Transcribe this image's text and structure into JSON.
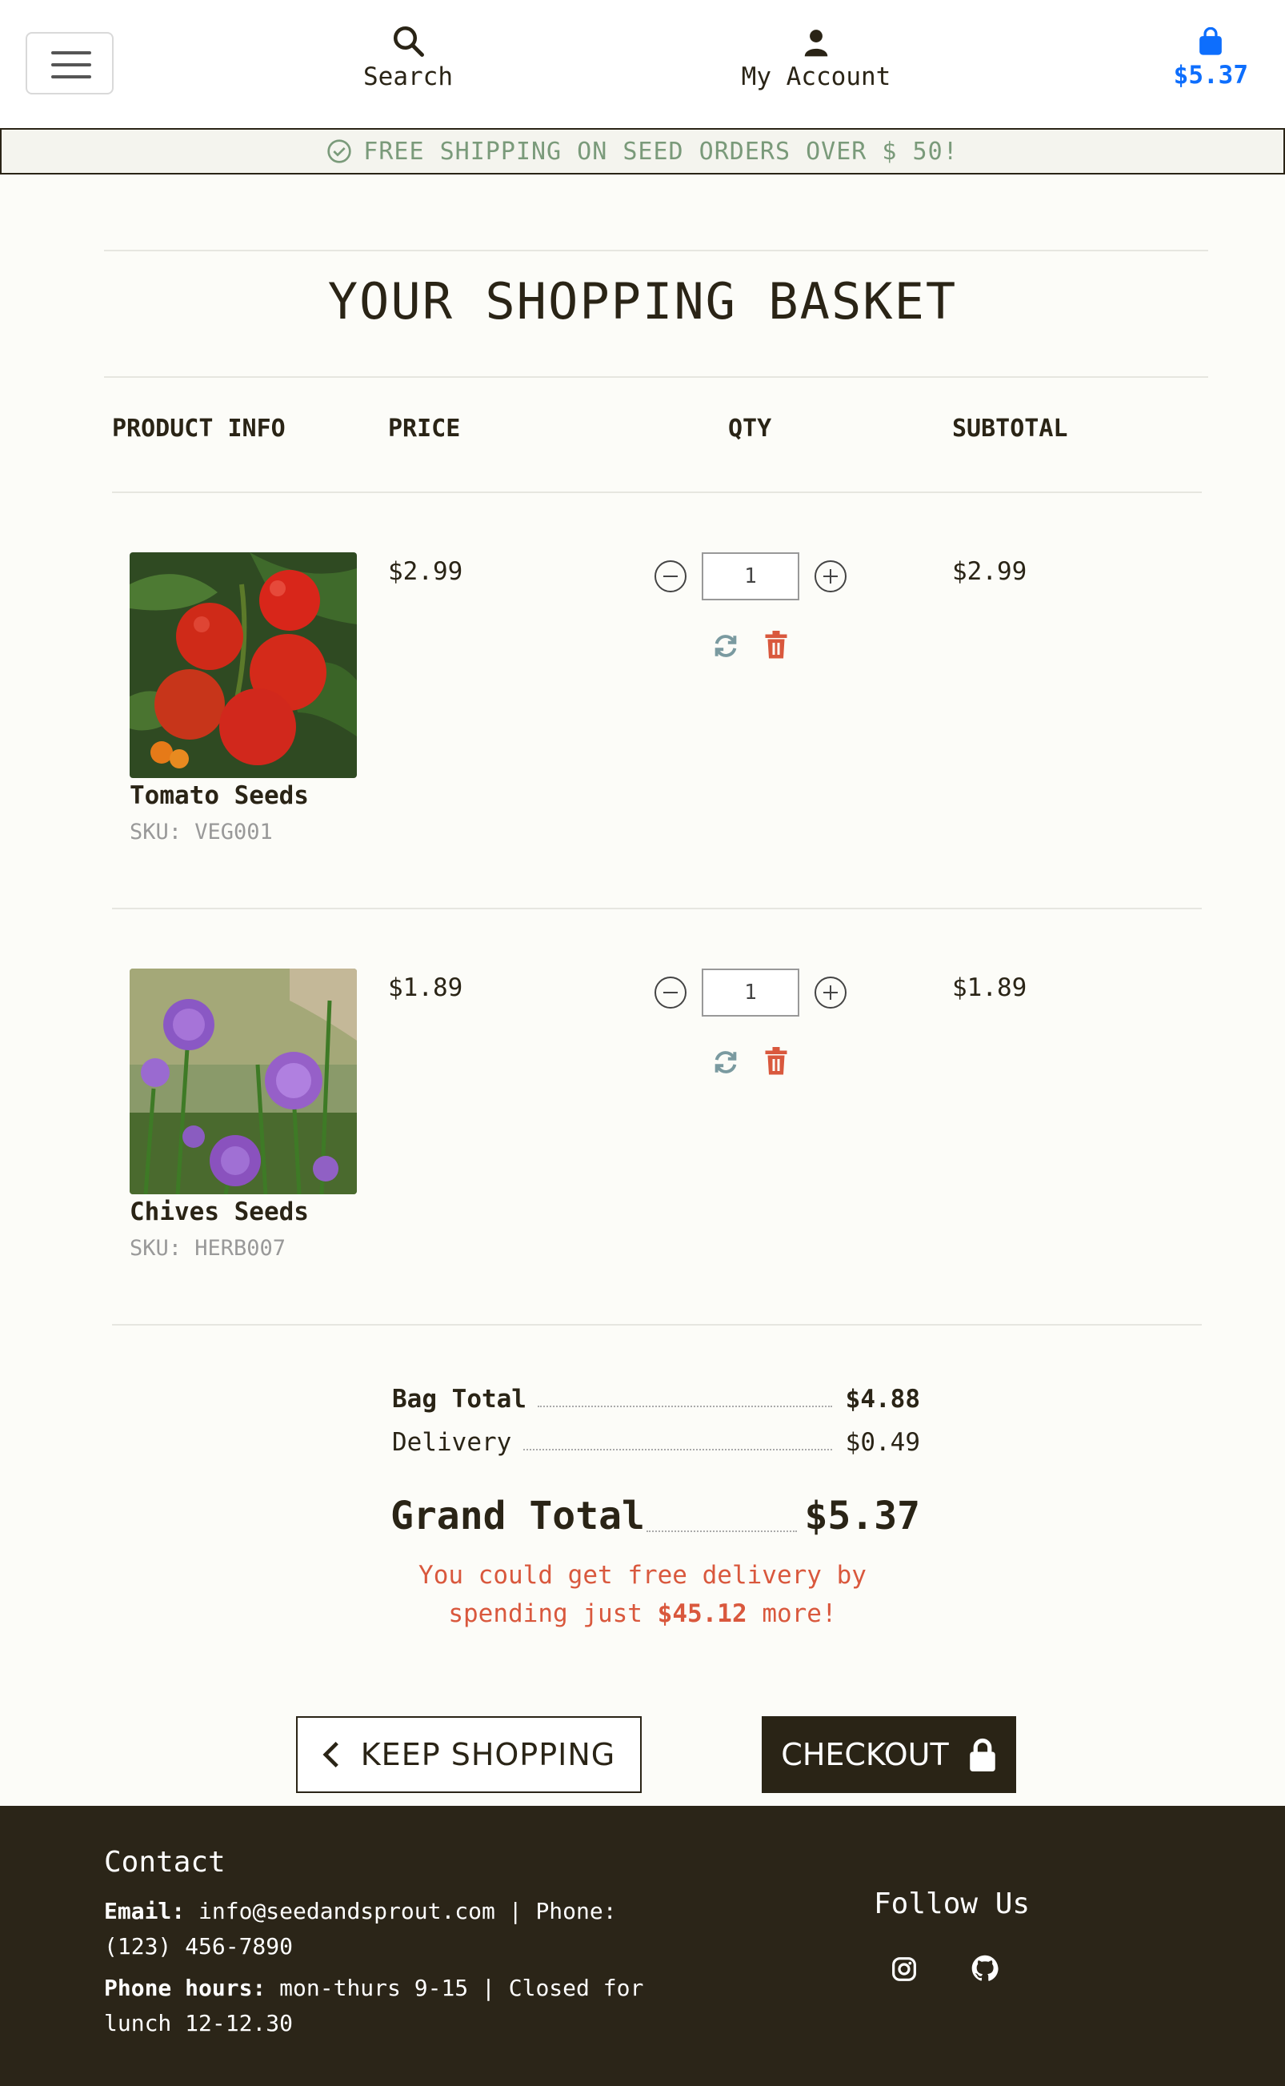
{
  "header": {
    "search_label": "Search",
    "account_label": "My Account",
    "basket_total": "$5.37"
  },
  "banner": {
    "text": "FREE SHIPPING ON SEED ORDERS OVER $ 50!"
  },
  "page": {
    "title": "YOUR SHOPPING BASKET"
  },
  "columns": {
    "product": "PRODUCT INFO",
    "price": "PRICE",
    "qty": "QTY",
    "subtotal": "SUBTOTAL"
  },
  "items": [
    {
      "name": "Tomato Seeds",
      "sku": "SKU: VEG001",
      "price": "$2.99",
      "qty": "1",
      "subtotal": "$2.99"
    },
    {
      "name": "Chives Seeds",
      "sku": "SKU: HERB007",
      "price": "$1.89",
      "qty": "1",
      "subtotal": "$1.89"
    }
  ],
  "totals": {
    "bag_label": "Bag Total",
    "bag_value": "$4.88",
    "delivery_label": "Delivery",
    "delivery_value": "$0.49",
    "grand_label": "Grand Total",
    "grand_value": "$5.37",
    "free_msg_a": "You could get free delivery by",
    "free_msg_b": "spending just",
    "free_amount": "$45.12",
    "free_msg_c": "more!"
  },
  "buttons": {
    "keep_shopping": "KEEP SHOPPING",
    "checkout": "CHECKOUT"
  },
  "footer": {
    "contact_title": "Contact",
    "email_label": "Email:",
    "email_text": "info@seedandsprout.com | Phone:",
    "phone_number": "(123) 456-7890",
    "hours_label": "Phone hours:",
    "hours_text": "mon-thurs 9-15 | Closed for",
    "hours_text_2": "lunch 12-12.30",
    "follow_title": "Follow Us"
  },
  "colors": {
    "accent": "#0d6efd",
    "dark": "#2a2416",
    "alert": "#d9583d",
    "success": "#7a9a7a"
  }
}
